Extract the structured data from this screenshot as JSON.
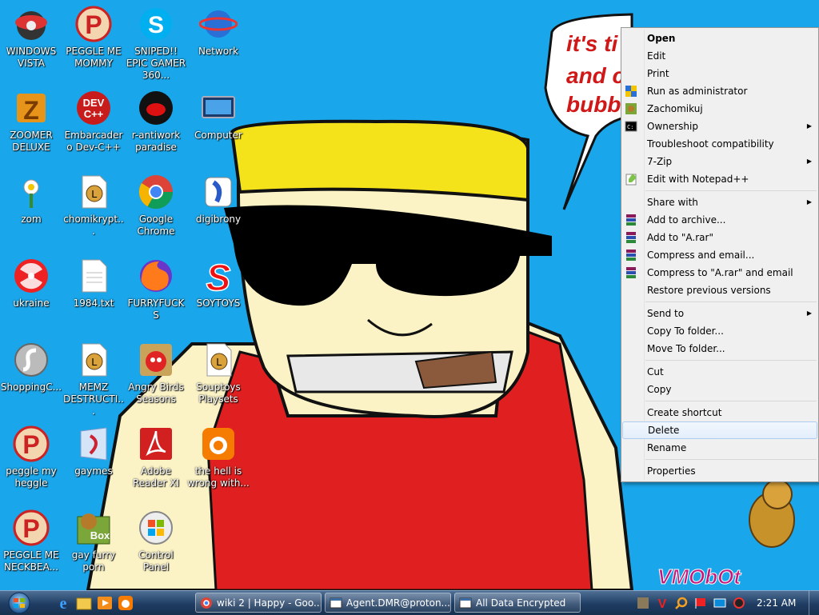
{
  "wallpaper": {
    "speech_lines": [
      "it's ti",
      "and c",
      "bubb"
    ],
    "watermark": "VMObOt"
  },
  "desktop_icons": [
    {
      "label": "WINDOWS VISTA",
      "icon": "vista-ball-icon"
    },
    {
      "label": "PEGGLE ME MOMMY",
      "icon": "peggle-icon"
    },
    {
      "label": "SNIPED!! EPIC GAMER 360...",
      "icon": "skype-icon"
    },
    {
      "label": "Network",
      "icon": "network-icon"
    },
    {
      "label": "ZOOMER DELUXE",
      "icon": "zoomer-icon"
    },
    {
      "label": "Embarcadero Dev-C++",
      "icon": "devcpp-icon"
    },
    {
      "label": "r-antiwork paradise",
      "icon": "reddit-icon"
    },
    {
      "label": "Computer",
      "icon": "computer-icon"
    },
    {
      "label": "zom",
      "icon": "flower-icon"
    },
    {
      "label": "chomikrypt...",
      "icon": "chomik-file-icon"
    },
    {
      "label": "Google Chrome",
      "icon": "chrome-icon"
    },
    {
      "label": "digibrony",
      "icon": "digibrony-icon"
    },
    {
      "label": "ukraine",
      "icon": "radiation-icon"
    },
    {
      "label": "1984.txt",
      "icon": "text-file-icon"
    },
    {
      "label": "FURRYFUCKS",
      "icon": "firefox-icon"
    },
    {
      "label": "SOYTOYS",
      "icon": "soytoys-icon"
    },
    {
      "label": "ShoppingC...",
      "icon": "flash-icon"
    },
    {
      "label": "MEMZ DESTRUCTI...",
      "icon": "memz-file-icon"
    },
    {
      "label": "Angry Birds Seasons",
      "icon": "angry-birds-icon"
    },
    {
      "label": "Souptoys Playsets",
      "icon": "souptoys-file-icon"
    },
    {
      "label": "peggle my heggle",
      "icon": "peggle-icon"
    },
    {
      "label": "gaymes",
      "icon": "folder-icon"
    },
    {
      "label": "Adobe Reader XI",
      "icon": "adobe-reader-icon"
    },
    {
      "label": "the hell is wrong with...",
      "icon": "uc-browser-icon"
    },
    {
      "label": "PEGGLE ME NECKBEA...",
      "icon": "peggle-icon"
    },
    {
      "label": "gay furry porn",
      "icon": "box-beaver-icon"
    },
    {
      "label": "Control Panel",
      "icon": "control-panel-icon"
    }
  ],
  "context_menu": {
    "items": [
      {
        "label": "Open",
        "bold": true
      },
      {
        "label": "Edit"
      },
      {
        "label": "Print"
      },
      {
        "label": "Run as administrator",
        "icon": "uac-shield-icon"
      },
      {
        "label": "Zachomikuj",
        "icon": "zachomikuj-icon"
      },
      {
        "label": "Ownership",
        "icon": "cmd-icon",
        "submenu": true
      },
      {
        "label": "Troubleshoot compatibility"
      },
      {
        "label": "7-Zip",
        "submenu": true
      },
      {
        "label": "Edit with Notepad++",
        "icon": "notepadpp-icon"
      },
      {
        "separator": true
      },
      {
        "label": "Share with",
        "submenu": true
      },
      {
        "label": "Add to archive...",
        "icon": "winrar-icon"
      },
      {
        "label": "Add to \"A.rar\"",
        "icon": "winrar-icon"
      },
      {
        "label": "Compress and email...",
        "icon": "winrar-icon"
      },
      {
        "label": "Compress to \"A.rar\" and email",
        "icon": "winrar-icon"
      },
      {
        "label": "Restore previous versions"
      },
      {
        "separator": true
      },
      {
        "label": "Send to",
        "submenu": true
      },
      {
        "label": "Copy To folder..."
      },
      {
        "label": "Move To folder..."
      },
      {
        "separator": true
      },
      {
        "label": "Cut"
      },
      {
        "label": "Copy"
      },
      {
        "separator": true
      },
      {
        "label": "Create shortcut"
      },
      {
        "label": "Delete",
        "highlighted": true
      },
      {
        "label": "Rename"
      },
      {
        "separator": true
      },
      {
        "label": "Properties"
      }
    ],
    "submenu_arrow": "▶"
  },
  "taskbar": {
    "quick_launch": [
      "ie-icon",
      "explorer-icon",
      "media-player-icon",
      "uc-browser-icon"
    ],
    "tasks": [
      {
        "label": "wiki 2 | Happy - Goo...",
        "icon": "chrome-icon"
      },
      {
        "label": "Agent.DMR@proton...",
        "icon": "window-icon"
      },
      {
        "label": "All Data Encrypted",
        "icon": "window-icon"
      }
    ],
    "tray_icons": [
      "beaver-tray-icon",
      "vivaldi-tray-icon",
      "search-tray-icon",
      "flag-tray-icon",
      "network-tray-icon",
      "volume-tray-icon"
    ],
    "clock": "2:21 AM"
  },
  "colors": {
    "desktop_bg": "#1aa6ea",
    "menu_highlight": "#e3eefb",
    "taskbar": "#1f3c62"
  }
}
